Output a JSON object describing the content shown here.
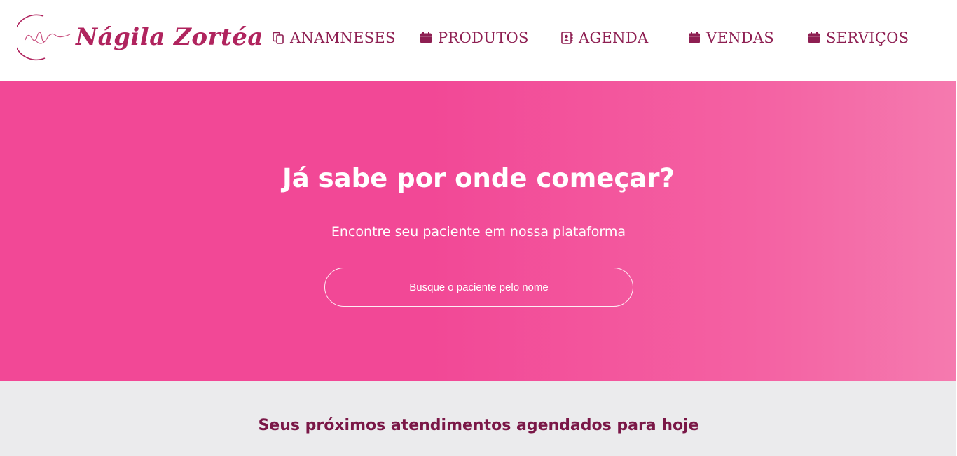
{
  "brand": {
    "name": "Nágila Zortéa",
    "colors": {
      "primary": "#f24896",
      "nav_text": "#8e1f52",
      "heading_dark": "#7a1747",
      "section_bg": "#ebebed"
    }
  },
  "nav": {
    "items": [
      {
        "label": "ANAMNESES",
        "icon": "documents-icon"
      },
      {
        "label": "PRODUTOS",
        "icon": "calendar-icon"
      },
      {
        "label": "AGENDA",
        "icon": "contact-book-icon"
      },
      {
        "label": "VENDAS",
        "icon": "calendar-icon"
      },
      {
        "label": "SERVIÇOS",
        "icon": "calendar-icon"
      }
    ]
  },
  "hero": {
    "title": "Já sabe por onde começar?",
    "subtitle": "Encontre seu paciente em nossa plataforma",
    "search_placeholder": "Busque o paciente pelo nome",
    "search_value": ""
  },
  "appointments": {
    "title": "Seus próximos atendimentos agendados para hoje"
  }
}
